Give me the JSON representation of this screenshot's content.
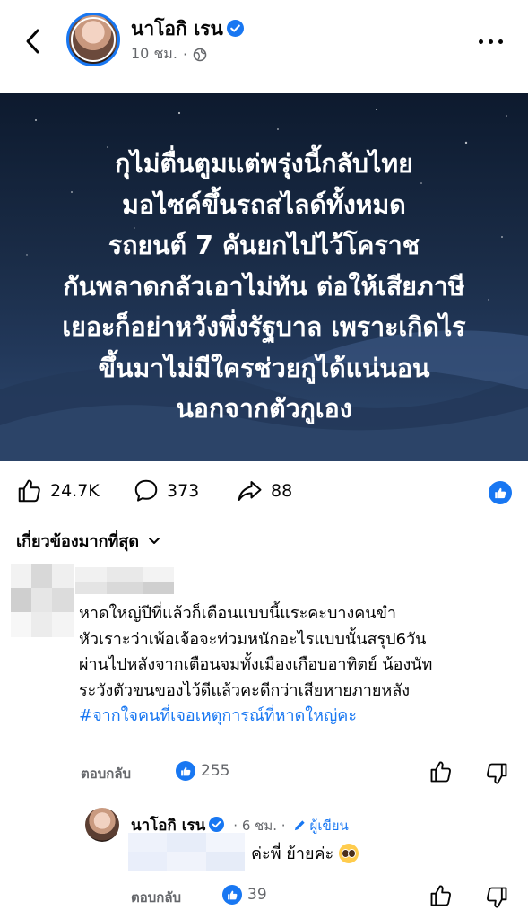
{
  "header": {
    "author_name": "นาโอกิ เรน",
    "time_ago": "10 ชม.",
    "separator": "·",
    "icons": {
      "back": "chevron-left-icon",
      "verified": "verified-badge-icon",
      "audience": "globe-icon",
      "more": "more-dots-icon"
    }
  },
  "post": {
    "lines": [
      "กุไม่ตื่นตูมแต่พรุ่งนี้กลับไทย",
      "มอไซค์ขึ้นรถสไลด์ทั้งหมด",
      "รถยนต์ 7 คันยกไปไว้โคราช",
      "กันพลาดกลัวเอาไม่ทัน ต่อให้เสียภาษี",
      "เยอะก็อย่าหวังพึ่งรัฐบาล เพราะเกิดไร",
      "ขึ้นมาไม่มีใครช่วยกูได้แน่นอน",
      "นอกจากตัวกูเอง"
    ]
  },
  "stats": {
    "likes": "24.7K",
    "comments": "373",
    "shares": "88"
  },
  "filter": {
    "label": "เกี่ยวข้องมากที่สุด"
  },
  "comments": [
    {
      "lines": [
        "หาดใหญ่ปีที่แล้วก็เตือนแบบนี้แระคะบางคนขำ",
        "หัวเราะว่าเพ้อเจ้อจะท่วมหนักอะไรแบบนั้นสรุป6วัน",
        "ผ่านไปหลังจากเตือนจมทั้งเมืองเกือบอาทิตย์ น้องนัท",
        "ระวังตัวขนของไว้ดีแล้วคะดีกว่าเสียหายภายหลัง"
      ],
      "hashtag": "#จากใจคนที่เจอเหตุการณ์ที่หาดใหญ่คะ",
      "reply_label": "ตอบกลับ",
      "like_count": "255"
    }
  ],
  "reply": {
    "name": "นาโอกิ เรน",
    "time_ago": "· 6 ชม. ·",
    "author_badge": "ผู้เขียน",
    "text": "ค่ะพี่ ย้ายค่ะ",
    "reply_label": "ตอบกลับ",
    "like_count": "39"
  },
  "colors": {
    "accent": "#1877f2",
    "secondary_text": "#65676b",
    "image_bg": "#1a2c47"
  }
}
